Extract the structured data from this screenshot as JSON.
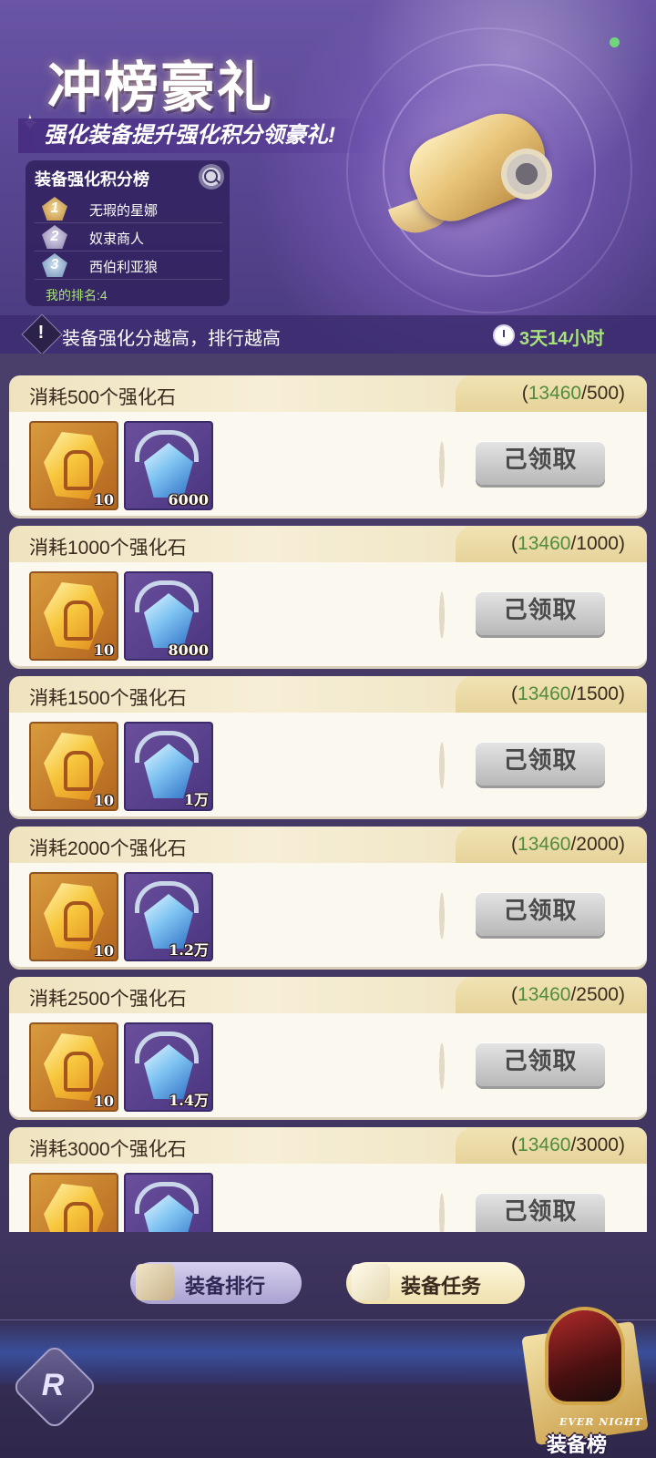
{
  "banner": {
    "title": "冲榜豪礼",
    "subtitle": "强化装备提升强化积分领豪礼!",
    "leaderboard": {
      "heading": "装备强化积分榜",
      "entries": [
        {
          "rank": "1",
          "name": "无瑕的星娜"
        },
        {
          "rank": "2",
          "name": "奴隶商人"
        },
        {
          "rank": "3",
          "name": "西伯利亚狼"
        }
      ],
      "my_rank": "我的排名:4"
    },
    "info_text": "装备强化分越高，排行越高",
    "timer": "3天14小时"
  },
  "cards": [
    {
      "title": "消耗500个强化石",
      "current": "13460",
      "target": "/500",
      "rewards": [
        "10",
        "6000"
      ],
      "button": "己领取"
    },
    {
      "title": "消耗1000个强化石",
      "current": "13460",
      "target": "/1000",
      "rewards": [
        "10",
        "8000"
      ],
      "button": "己领取"
    },
    {
      "title": "消耗1500个强化石",
      "current": "13460",
      "target": "/1500",
      "rewards": [
        "10",
        "1万"
      ],
      "button": "己领取"
    },
    {
      "title": "消耗2000个强化石",
      "current": "13460",
      "target": "/2000",
      "rewards": [
        "10",
        "1.2万"
      ],
      "button": "己领取"
    },
    {
      "title": "消耗2500个强化石",
      "current": "13460",
      "target": "/2500",
      "rewards": [
        "10",
        "1.4万"
      ],
      "button": "己领取"
    },
    {
      "title": "消耗3000个强化石",
      "current": "13460",
      "target": "/3000",
      "rewards": [
        "",
        ""
      ],
      "button": "己领取"
    }
  ],
  "bottom_nav": {
    "rank_tab": "装备排行",
    "task_tab": "装备任务",
    "logo_letter": "R",
    "equip_rank_small": "EVER NIGHT",
    "equip_rank_label": "装备榜"
  },
  "colors": {
    "accent_green": "#a8e27a",
    "progress_green": "#4f8c3e",
    "banner_purple": "#5a4794",
    "card_cream": "#fbf8f0"
  },
  "icons": [
    "search-icon",
    "warning-icon",
    "timer-icon",
    "gold-stone-icon",
    "blue-crystal-icon",
    "chest-icon",
    "scroll-icon"
  ]
}
